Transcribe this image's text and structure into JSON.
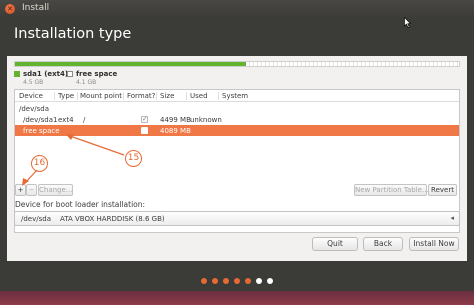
{
  "window": {
    "title": "Install",
    "close_glyph": "✕"
  },
  "page": {
    "title": "Installation type"
  },
  "partition_bar": {
    "used_fraction": 0.52,
    "used_color": "#62b32f",
    "legend": [
      {
        "name": "sda1 (ext4)",
        "size": "4.5 GB",
        "color": "#62b32f"
      },
      {
        "name": "free space",
        "size": "4.1 GB",
        "color": "#ffffff"
      }
    ]
  },
  "table": {
    "columns": [
      "Device",
      "Type",
      "Mount point",
      "Format?",
      "Size",
      "Used",
      "System"
    ],
    "group": "/dev/sda",
    "rows": [
      {
        "device": "/dev/sda1",
        "type": "ext4",
        "mount": "/",
        "format_checked": true,
        "size": "4499 MB",
        "used": "unknown",
        "system": ""
      },
      {
        "device": "free space",
        "type": "",
        "mount": "",
        "format_checked": false,
        "size": "4089 MB",
        "used": "",
        "system": "",
        "selected": true
      }
    ],
    "selected_color": "#f07746"
  },
  "toolbar": {
    "add_label": "+",
    "remove_label": "−",
    "change_label": "Change...",
    "new_table_label": "New Partition Table...",
    "revert_label": "Revert"
  },
  "bootloader": {
    "label": "Device for boot loader installation:",
    "device": "/dev/sda",
    "description": "ATA VBOX HARDDISK (8.6 GB)"
  },
  "actions": {
    "quit": "Quit",
    "back": "Back",
    "install": "Install Now"
  },
  "annotations": {
    "callout_15": "15",
    "callout_16": "16",
    "color": "#e76a35"
  },
  "progress": {
    "total_steps": 7,
    "completed_steps": 5,
    "active_color": "#e76a35",
    "inactive_color": "#ffffff"
  }
}
